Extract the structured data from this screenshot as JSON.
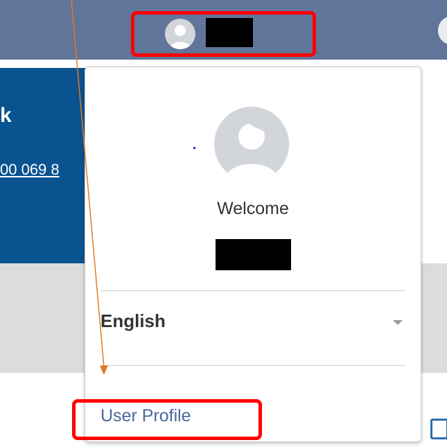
{
  "blue_panel": {
    "heading_fragment": "k",
    "phone_fragment": "00 069 8"
  },
  "user_menu": {
    "welcome": "Welcome",
    "language": {
      "selected": "English"
    },
    "user_profile_link": "User Profile"
  },
  "icons": {
    "header_avatar": "user-avatar-icon",
    "menu_avatar": "user-avatar-icon",
    "language_caret": "chevron-down-icon",
    "export": "export-icon"
  },
  "colors": {
    "header_bar": "#61749a",
    "blue_panel": "#0a5391",
    "link": "#49689d",
    "highlight": "#ff0000",
    "annotation_arrow": "#e07a26"
  }
}
